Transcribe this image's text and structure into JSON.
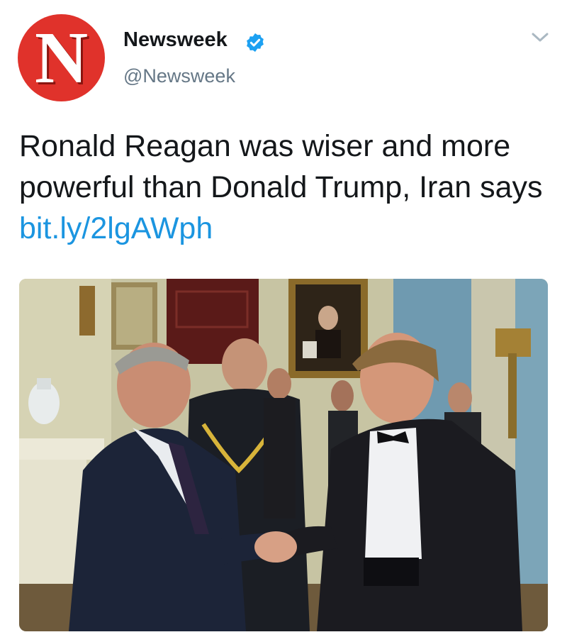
{
  "account": {
    "avatar_letter": "N",
    "display_name": "Newsweek",
    "handle": "@Newsweek",
    "verified": true,
    "brand_color": "#e0322b"
  },
  "tweet": {
    "text": "Ronald Reagan was wiser and more powerful than Donald Trump, Iran says",
    "link": "bit.ly/2lgAWph",
    "link_color": "#1b95e0"
  },
  "media": {
    "type": "photo"
  },
  "icons": {
    "verified": "verified-badge-icon",
    "menu": "chevron-down-icon"
  }
}
